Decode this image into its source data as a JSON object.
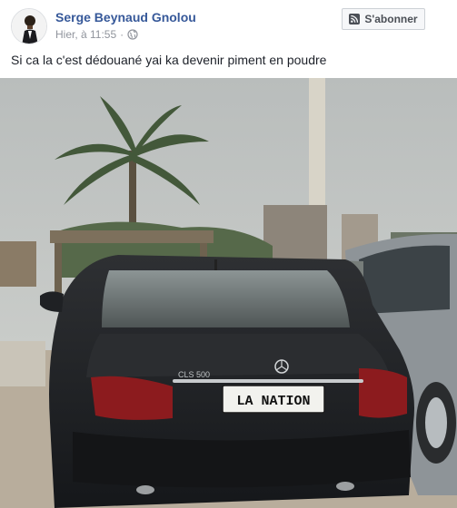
{
  "post": {
    "author": "Serge Beynaud Gnolou",
    "timestamp": "Hier, à 11:55",
    "separator": "·",
    "subscribe_label": "S'abonner",
    "text": "Si ca la c'est dédouané yai ka devenir piment en poudre"
  },
  "photo": {
    "plate_text": "LA NATION",
    "badge_text": "CLS 500"
  },
  "colors": {
    "link_blue": "#365899",
    "meta_gray": "#90949c",
    "text": "#1d2129"
  },
  "icons": {
    "audience": "globe-icon",
    "subscribe": "rss-icon"
  }
}
